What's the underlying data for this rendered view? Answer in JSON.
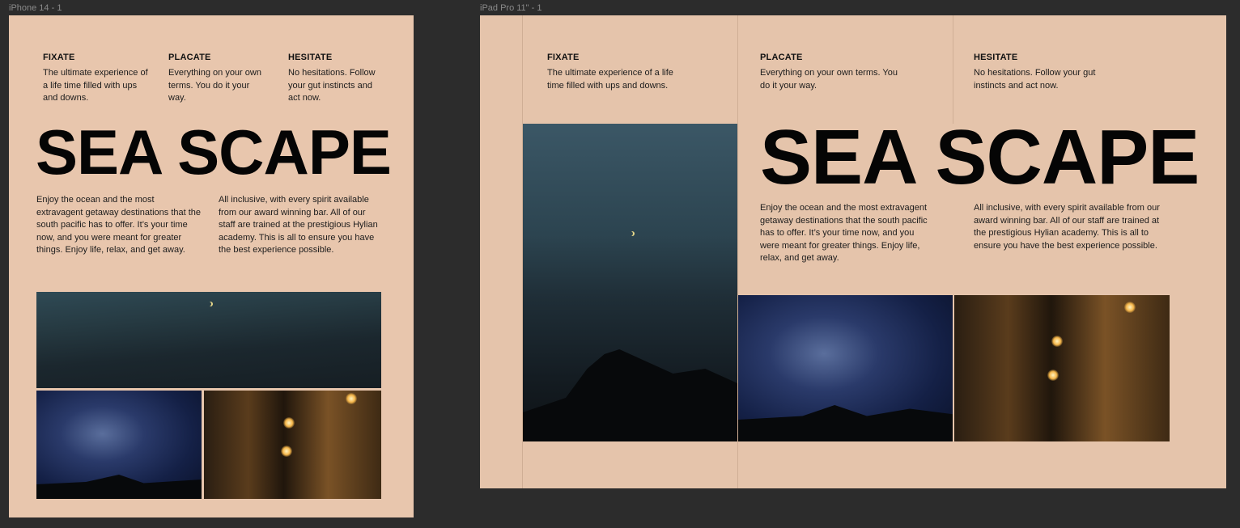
{
  "frames": [
    {
      "label": "iPhone 14 - 1"
    },
    {
      "label": "iPad Pro 11\" - 1"
    }
  ],
  "features": [
    {
      "title": "FIXATE",
      "text": "The ultimate experience of a life time filled with ups and downs."
    },
    {
      "title": "PLACATE",
      "text": "Everything on your own terms. You do it your way."
    },
    {
      "title": "HESITATE",
      "text": "No hesitations. Follow your gut instincts and act now."
    }
  ],
  "headline": "SEA SCAPE",
  "paragraphs": [
    "Enjoy the ocean and the most extravagent getaway destinations that the south pacific has to offer. It’s your time now, and you were meant for greater things. Enjoy life, relax, and get away.",
    "All inclusive, with every spirit available from our award winning bar. All of our staff are trained at the prestigious Hylian academy. This is all to ensure you have the best experience possible."
  ],
  "colors": {
    "canvas": "#2c2c2c",
    "frame_bg": "#e8c6ad",
    "text": "#111111"
  }
}
